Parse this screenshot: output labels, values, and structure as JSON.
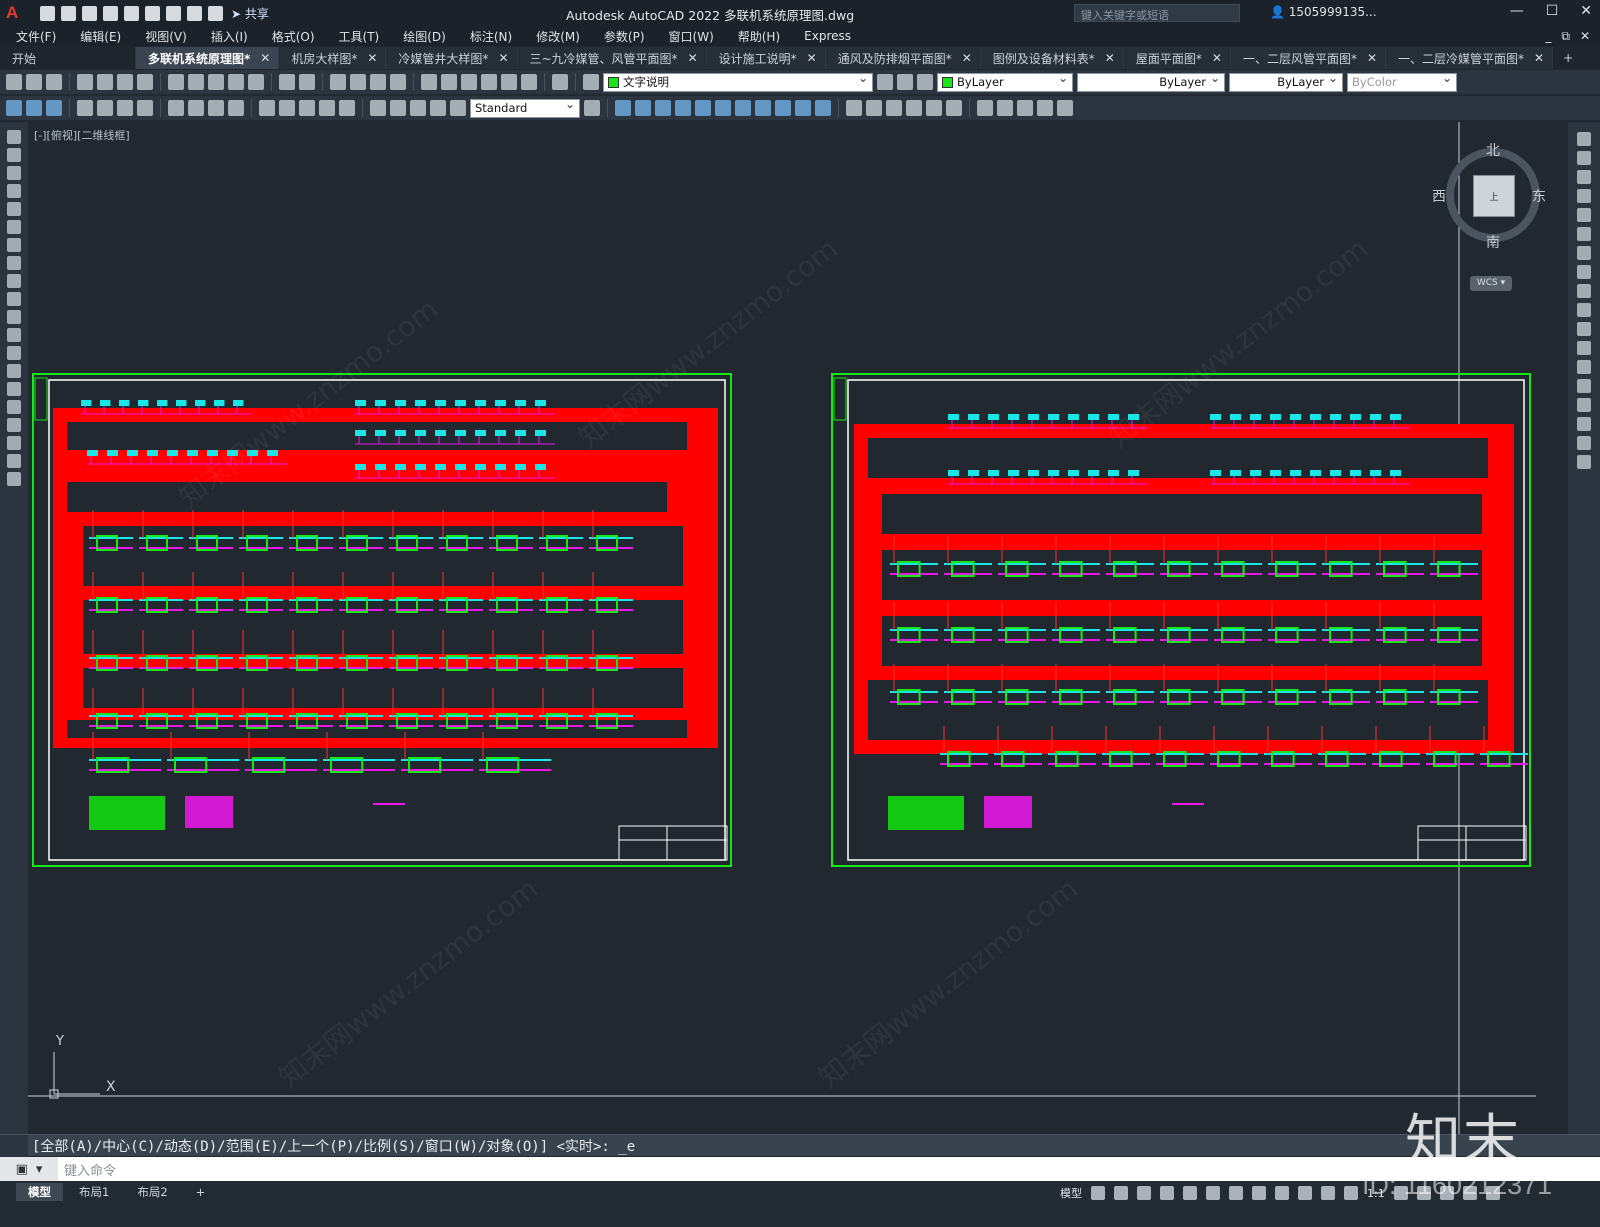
{
  "title_bar": {
    "app_logo": "A",
    "share_label": "共享",
    "title": "Autodesk AutoCAD 2022    多联机系统原理图.dwg",
    "search_placeholder": "键入关键字或短语",
    "user": "1505999135...",
    "window_buttons": [
      "—",
      "☐",
      "✕"
    ]
  },
  "menu": [
    "文件(F)",
    "编辑(E)",
    "视图(V)",
    "插入(I)",
    "格式(O)",
    "工具(T)",
    "绘图(D)",
    "标注(N)",
    "修改(M)",
    "参数(P)",
    "窗口(W)",
    "帮助(H)",
    "Express"
  ],
  "tabs": [
    {
      "label": "开始",
      "active": false,
      "closable": false
    },
    {
      "label": "多联机系统原理图*",
      "active": true,
      "closable": true
    },
    {
      "label": "机房大样图*",
      "active": false,
      "closable": true
    },
    {
      "label": "冷媒管井大样图*",
      "active": false,
      "closable": true
    },
    {
      "label": "三~九冷媒管、风管平面图*",
      "active": false,
      "closable": true
    },
    {
      "label": "设计施工说明*",
      "active": false,
      "closable": true
    },
    {
      "label": "通风及防排烟平面图*",
      "active": false,
      "closable": true
    },
    {
      "label": "图例及设备材料表*",
      "active": false,
      "closable": true
    },
    {
      "label": "屋面平面图*",
      "active": false,
      "closable": true
    },
    {
      "label": "一、二层风管平面图*",
      "active": false,
      "closable": true
    },
    {
      "label": "一、二层冷媒管平面图*",
      "active": false,
      "closable": true
    }
  ],
  "toolbar": {
    "layer_name": "文字说明",
    "color": "ByLayer",
    "linetype": "ByLayer",
    "lineweight": "ByLayer",
    "plotstyle": "ByColor",
    "textstyle": "Standard"
  },
  "viewport": {
    "label": "[-][俯视][二维线框]",
    "compass": {
      "north": "北",
      "south": "南",
      "east": "东",
      "west": "西",
      "face": "上"
    },
    "wcs": "WCS ▾",
    "ucs_x": "X",
    "ucs_y": "Y"
  },
  "command": {
    "history": "[全部(A)/中心(C)/动态(D)/范围(E)/上一个(P)/比例(S)/窗口(W)/对象(O)] <实时>: _e",
    "placeholder": "键入命令"
  },
  "layout_tabs": [
    "模型",
    "布局1",
    "布局2",
    "+"
  ],
  "status": {
    "model_label": "模型",
    "scale": "1:1"
  },
  "watermark": {
    "brand": "知末",
    "id": "ID: 1160212371",
    "site": "知末网www.znzmo.com"
  },
  "colors": {
    "background": "#212830",
    "frame_green": "#17e617",
    "pipe_red": "#ff0000",
    "unit_cyan": "#19e6e6",
    "branch_magenta": "#e619e6"
  }
}
